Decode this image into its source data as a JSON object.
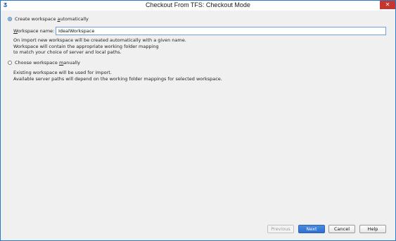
{
  "window": {
    "title": "Checkout From TFS: Checkout Mode",
    "app_icon": "Ʒ",
    "close_glyph": "✕"
  },
  "options": {
    "auto": {
      "label_pre": "Create workspace ",
      "label_mnemonic": "a",
      "label_post": "utomatically",
      "selected": true,
      "field_label_mnemonic": "W",
      "field_label_rest": "orkspace name:",
      "workspace_name": "IdealWorkspace",
      "description": [
        "On import new workspace will be created automatically with a given name.",
        "Workspace will contain the appropriate working folder mapping",
        "to match your choice of server and local paths."
      ]
    },
    "manual": {
      "label_pre": "Choose workspace ",
      "label_mnemonic": "m",
      "label_post": "anually",
      "selected": false,
      "description": [
        "Existing workspace will be used for import.",
        "Available server paths will depend on the working folder mappings for selected workspace."
      ]
    }
  },
  "buttons": {
    "previous": "Previous",
    "next": "Next",
    "cancel": "Cancel",
    "help": "Help"
  },
  "colors": {
    "accent": "#2e6fcf",
    "window_border": "#2b78c8",
    "close": "#c7352c"
  }
}
